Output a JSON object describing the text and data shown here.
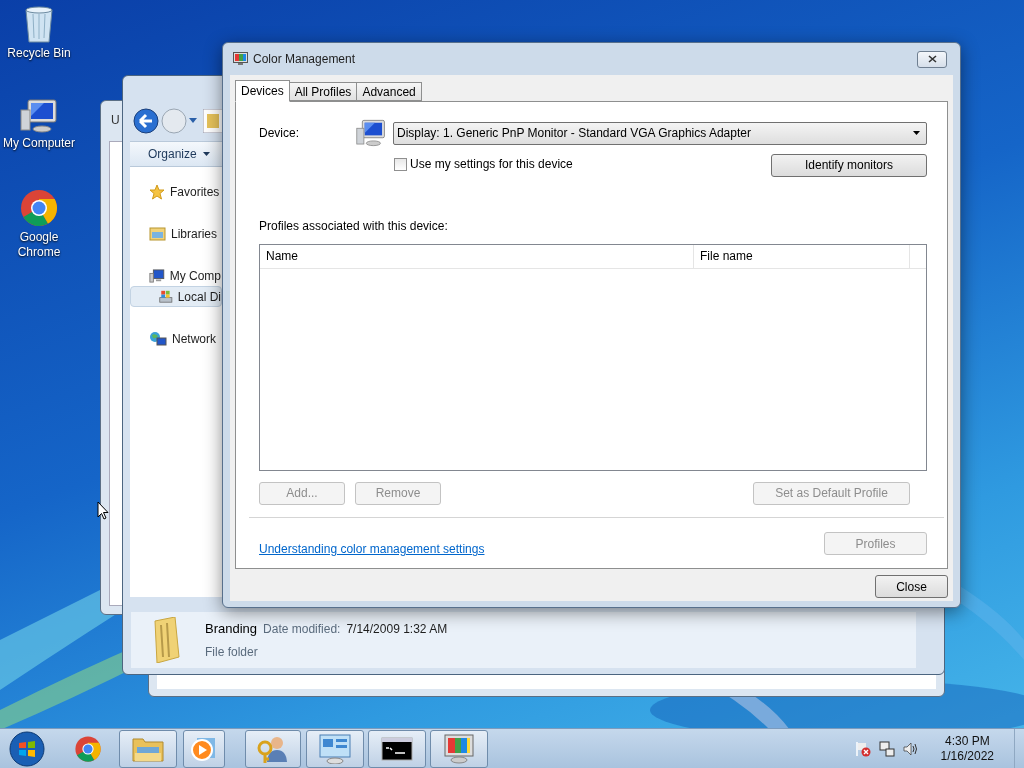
{
  "desktop_icons": [
    {
      "label": "Recycle Bin",
      "kind": "recycle"
    },
    {
      "label": "My Computer",
      "kind": "computer"
    },
    {
      "label": "Google Chrome",
      "kind": "chrome"
    }
  ],
  "back_window": {
    "title": "U"
  },
  "explorer": {
    "organize": "Organize",
    "nav": [
      {
        "label": "Favorites",
        "kind": "star",
        "selected": false
      },
      {
        "label": "Libraries",
        "kind": "library",
        "selected": false
      },
      {
        "label": "My Comp",
        "kind": "computer",
        "selected": false,
        "children": [
          {
            "label": "Local Di",
            "kind": "drive",
            "selected": true
          }
        ]
      },
      {
        "label": "Network",
        "kind": "network",
        "selected": false
      }
    ],
    "details": {
      "name": "Branding",
      "date_label": "Date modified:",
      "date": "7/14/2009 1:32 AM",
      "type": "File folder"
    }
  },
  "dialog": {
    "title": "Color Management",
    "tabs": [
      {
        "label": "Devices",
        "selected": true
      },
      {
        "label": "All Profiles",
        "selected": false
      },
      {
        "label": "Advanced",
        "selected": false
      }
    ],
    "device_label": "Device:",
    "device": "Display: 1. Generic PnP Monitor - Standard VGA Graphics Adapter",
    "use_settings": {
      "label": "Use my settings for this device",
      "checked": false
    },
    "identify": "Identify monitors",
    "profiles_label": "Profiles associated with this device:",
    "columns": [
      "Name",
      "File name"
    ],
    "buttons": [
      {
        "label": "Add...",
        "disabled": true
      },
      {
        "label": "Remove",
        "disabled": true
      },
      {
        "label": "Set as Default Profile",
        "disabled": true
      }
    ],
    "link": "Understanding color management settings",
    "profiles_button": {
      "label": "Profiles",
      "disabled": true
    },
    "close": "Close"
  },
  "taskbar": {
    "apps": [
      {
        "kind": "chrome",
        "running": false
      },
      {
        "kind": "folder",
        "running": true
      },
      {
        "kind": "media",
        "running": true
      },
      {
        "kind": "users",
        "running": true
      },
      {
        "kind": "panel",
        "running": true
      },
      {
        "kind": "console",
        "running": true
      },
      {
        "kind": "display",
        "running": true
      }
    ],
    "tray": [
      {
        "kind": "flag"
      },
      {
        "kind": "network"
      },
      {
        "kind": "speaker"
      }
    ],
    "time": "4:30 PM",
    "date": "1/16/2022"
  }
}
